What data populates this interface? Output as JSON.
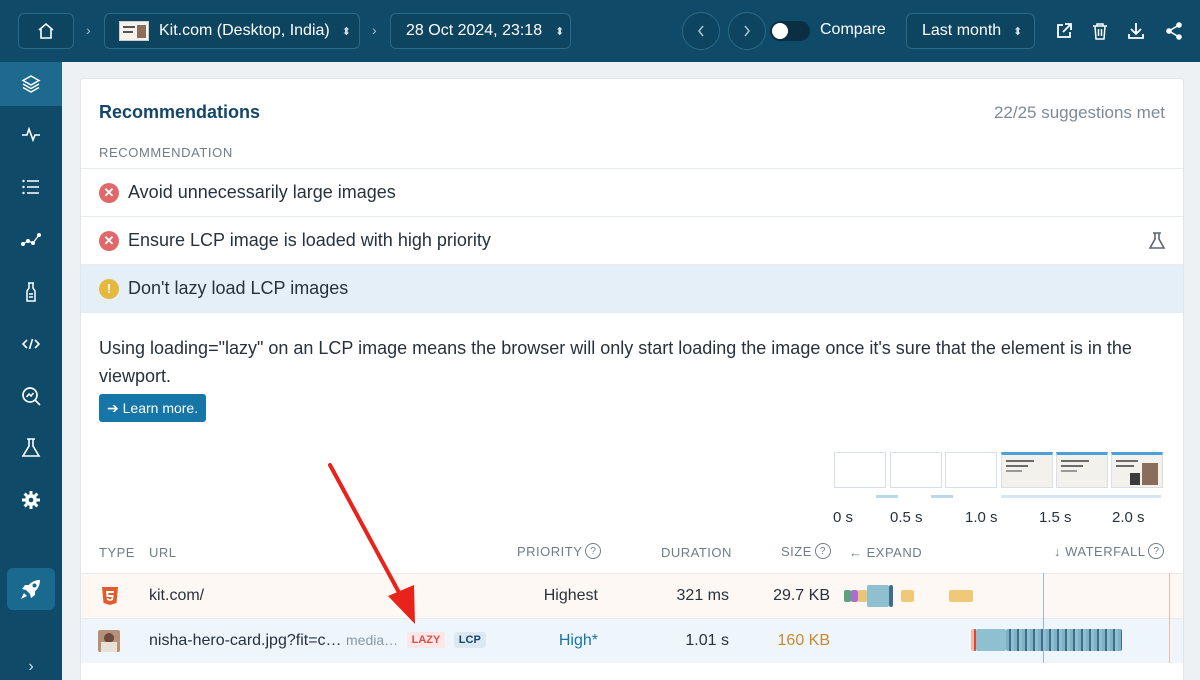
{
  "topbar": {
    "home_icon": "home-icon",
    "breadcrumb_separator": "›",
    "site_label": "Kit.com (Desktop, India)",
    "date_label": "28 Oct 2024, 23:18",
    "compare_label": "Compare",
    "range_label": "Last month",
    "icons": [
      "prev-icon",
      "next-icon",
      "external-link-icon",
      "trash-icon",
      "download-icon",
      "share-icon"
    ]
  },
  "sidebar": {
    "items": [
      "layers-icon",
      "pulse-icon",
      "list-icon",
      "scatter-icon",
      "lab-bottle-icon",
      "code-icon",
      "search-chart-icon",
      "flask-icon",
      "gear-icon"
    ],
    "bottom": "rocket-icon",
    "expand_glyph": "›"
  },
  "card": {
    "title": "Recommendations",
    "suggestions": "22/25 suggestions met",
    "column_header": "RECOMMENDATION",
    "recommendations": [
      {
        "status": "error",
        "text": "Avoid unnecessarily large images"
      },
      {
        "status": "error",
        "text": "Ensure LCP image is loaded with high priority"
      },
      {
        "status": "warning",
        "text": "Don't lazy load LCP images"
      }
    ],
    "detail_text": "Using loading=\"lazy\" on an LCP image means the browser will only start loading the image once it's sure that the element is in the viewport.",
    "learn_more": "➔ Learn more."
  },
  "filmstrip": {
    "ticks": [
      "0 s",
      "0.5 s",
      "1.0 s",
      "1.5 s",
      "2.0 s"
    ]
  },
  "table": {
    "headers": {
      "type": "TYPE",
      "url": "URL",
      "priority": "PRIORITY",
      "duration": "DURATION",
      "size": "SIZE",
      "expand": "← EXPAND",
      "waterfall": "↓ WATERFALL"
    },
    "rows": [
      {
        "type_icon": "html5-icon",
        "url": "kit.com/",
        "extra": "",
        "tags": [],
        "priority": "Highest",
        "duration": "321 ms",
        "size": "29.7 KB"
      },
      {
        "type_icon": "image-thumb-icon",
        "url": "nisha-hero-card.jpg?fit=c…",
        "extra": "media…",
        "tags": [
          "LAZY",
          "LCP"
        ],
        "priority": "High*",
        "duration": "1.01 s",
        "size": "160 KB"
      }
    ]
  },
  "colors": {
    "brand": "#0f4a68",
    "accent": "#1676a8",
    "error": "#e06868",
    "warning": "#e6b93e",
    "annotation": "#e8231c"
  }
}
